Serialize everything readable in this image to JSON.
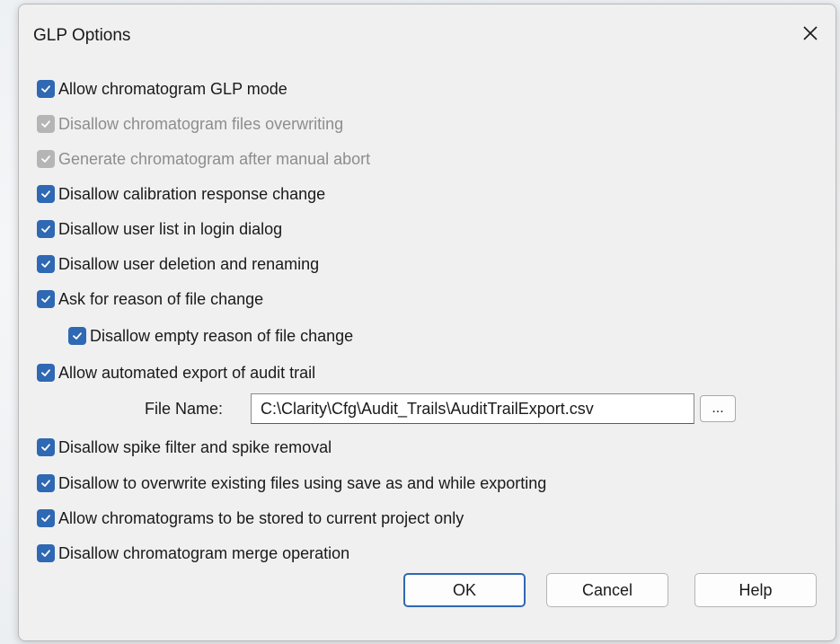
{
  "window": {
    "title": "GLP Options"
  },
  "options": [
    {
      "label": "Allow chromatogram GLP mode",
      "checked": true,
      "enabled": true,
      "indent": 0
    },
    {
      "label": "Disallow chromatogram files overwriting",
      "checked": true,
      "enabled": false,
      "indent": 0
    },
    {
      "label": "Generate chromatogram after manual abort",
      "checked": true,
      "enabled": false,
      "indent": 0
    },
    {
      "label": "Disallow calibration response change",
      "checked": true,
      "enabled": true,
      "indent": 0
    },
    {
      "label": "Disallow user list in login dialog",
      "checked": true,
      "enabled": true,
      "indent": 0
    },
    {
      "label": "Disallow user deletion and renaming",
      "checked": true,
      "enabled": true,
      "indent": 0
    },
    {
      "label": "Ask for reason of file change",
      "checked": true,
      "enabled": true,
      "indent": 0
    },
    {
      "label": "Disallow empty reason of file change",
      "checked": true,
      "enabled": true,
      "indent": 1
    },
    {
      "label": "Allow automated export of audit trail",
      "checked": true,
      "enabled": true,
      "indent": 0
    },
    {
      "label": "Disallow spike filter and spike removal",
      "checked": true,
      "enabled": true,
      "indent": 0
    },
    {
      "label": "Disallow to overwrite existing files using save as and while exporting",
      "checked": true,
      "enabled": true,
      "indent": 0
    },
    {
      "label": "Allow chromatograms to be stored to current project only",
      "checked": true,
      "enabled": true,
      "indent": 0
    },
    {
      "label": "Disallow chromatogram merge operation",
      "checked": true,
      "enabled": true,
      "indent": 0
    }
  ],
  "file_name": {
    "label": "File Name:",
    "value": "C:\\Clarity\\Cfg\\Audit_Trails\\AuditTrailExport.csv",
    "browse_label": "..."
  },
  "buttons": {
    "ok": "OK",
    "cancel": "Cancel",
    "help": "Help"
  },
  "colors": {
    "checkbox_checked": "#2f68b3",
    "checkbox_disabled": "#b5b5b5",
    "dialog_bg": "#f0f0f0",
    "default_button_border": "#2f68b3"
  },
  "icons": {
    "close": "close-icon",
    "check": "checkmark-icon"
  }
}
